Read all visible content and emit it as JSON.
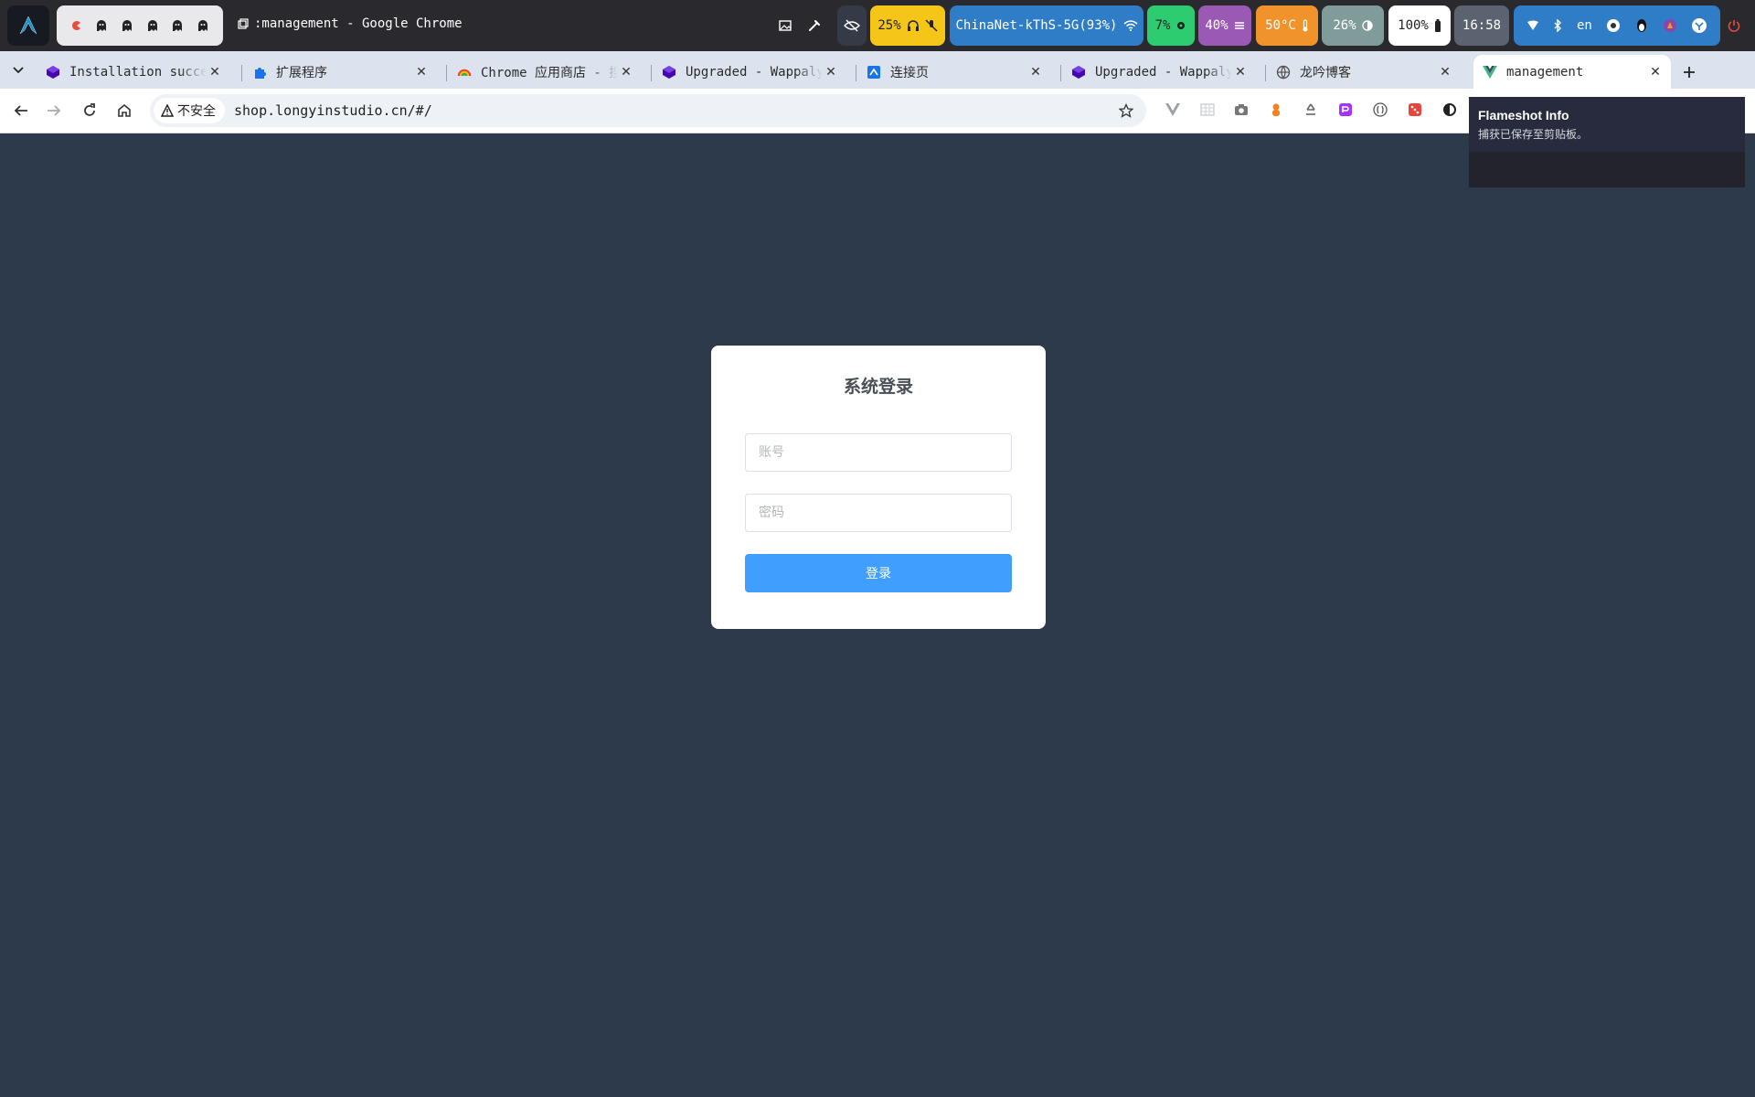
{
  "window": {
    "title": ":management - Google Chrome"
  },
  "statusbar": {
    "volume": "25%",
    "wifi": "ChinaNet-kThS-5G(93%)",
    "cpu": "7%",
    "memory": "40%",
    "temperature": "50°C",
    "brightness": "26%",
    "battery": "100%",
    "clock": "16:58",
    "language": "en",
    "colors": {
      "volume": "#f5c518",
      "wifi": "#2f7dc7",
      "cpu": "#2ecc71",
      "memory": "#9b59b6",
      "temperature": "#f0932b",
      "brightness": "#7f9c9b",
      "battery": "#ffffff",
      "clock": "#5c6370",
      "tray": "#2f7dc7"
    }
  },
  "tabs": [
    {
      "title": "Installation succe",
      "icon": "wappalyzer-icon"
    },
    {
      "title": "扩展程序",
      "icon": "extensions-icon"
    },
    {
      "title": "Chrome 应用商店 - 搜",
      "icon": "chrome-webstore-icon"
    },
    {
      "title": "Upgraded - Wappaly",
      "icon": "wappalyzer-icon"
    },
    {
      "title": "连接页",
      "icon": "connect-page-icon"
    },
    {
      "title": "Upgraded - Wappaly",
      "icon": "wappalyzer-icon"
    },
    {
      "title": "龙吟博客",
      "icon": "globe-icon"
    },
    {
      "title": "management",
      "icon": "vue-icon",
      "active": true
    }
  ],
  "toolbar": {
    "security_label": "不安全",
    "url": "shop.longyinstudio.cn/#/"
  },
  "notification": {
    "title": "Flameshot Info",
    "body": "捕获已保存至剪贴板。"
  },
  "login": {
    "title": "系统登录",
    "account_placeholder": "账号",
    "password_placeholder": "密码",
    "submit_label": "登录",
    "accent": "#409eff"
  },
  "page": {
    "background": "#2d3a4b"
  }
}
